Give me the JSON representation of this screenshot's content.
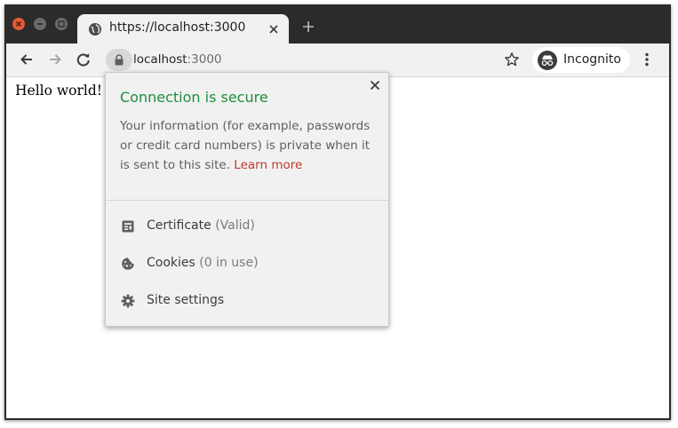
{
  "window_controls": {
    "close": "close-window-icon",
    "minimize": "minimize-window-icon",
    "maximize": "maximize-window-icon"
  },
  "tabs": [
    {
      "title": "https://localhost:3000",
      "icon": "globe-icon",
      "close_icon": "close-tab-icon"
    }
  ],
  "new_tab_icon": "plus-icon",
  "toolbar": {
    "back_icon": "arrow-left-icon",
    "forward_icon": "arrow-right-icon",
    "reload_icon": "reload-icon",
    "address": {
      "lock_icon": "lock-icon",
      "host": "localhost",
      "rest": ":3000"
    },
    "bookmark_icon": "star-icon",
    "incognito": {
      "label": "Incognito",
      "icon": "incognito-icon"
    },
    "menu_icon": "three-dots-menu-icon"
  },
  "page": {
    "text": "Hello world!"
  },
  "site_info_popup": {
    "heading": "Connection is secure",
    "body": "Your information (for example, passwords or credit card numbers) is private when it is sent to this site.",
    "learn_more": "Learn more",
    "heading_color": "#1e8e3e",
    "link_color": "#c0392b",
    "rows": [
      {
        "label": "Certificate",
        "detail": "(Valid)",
        "icon": "certificate-icon"
      },
      {
        "label": "Cookies",
        "detail": "(0 in use)",
        "icon": "cookie-icon"
      },
      {
        "label": "Site settings",
        "detail": "",
        "icon": "gear-icon"
      }
    ]
  }
}
